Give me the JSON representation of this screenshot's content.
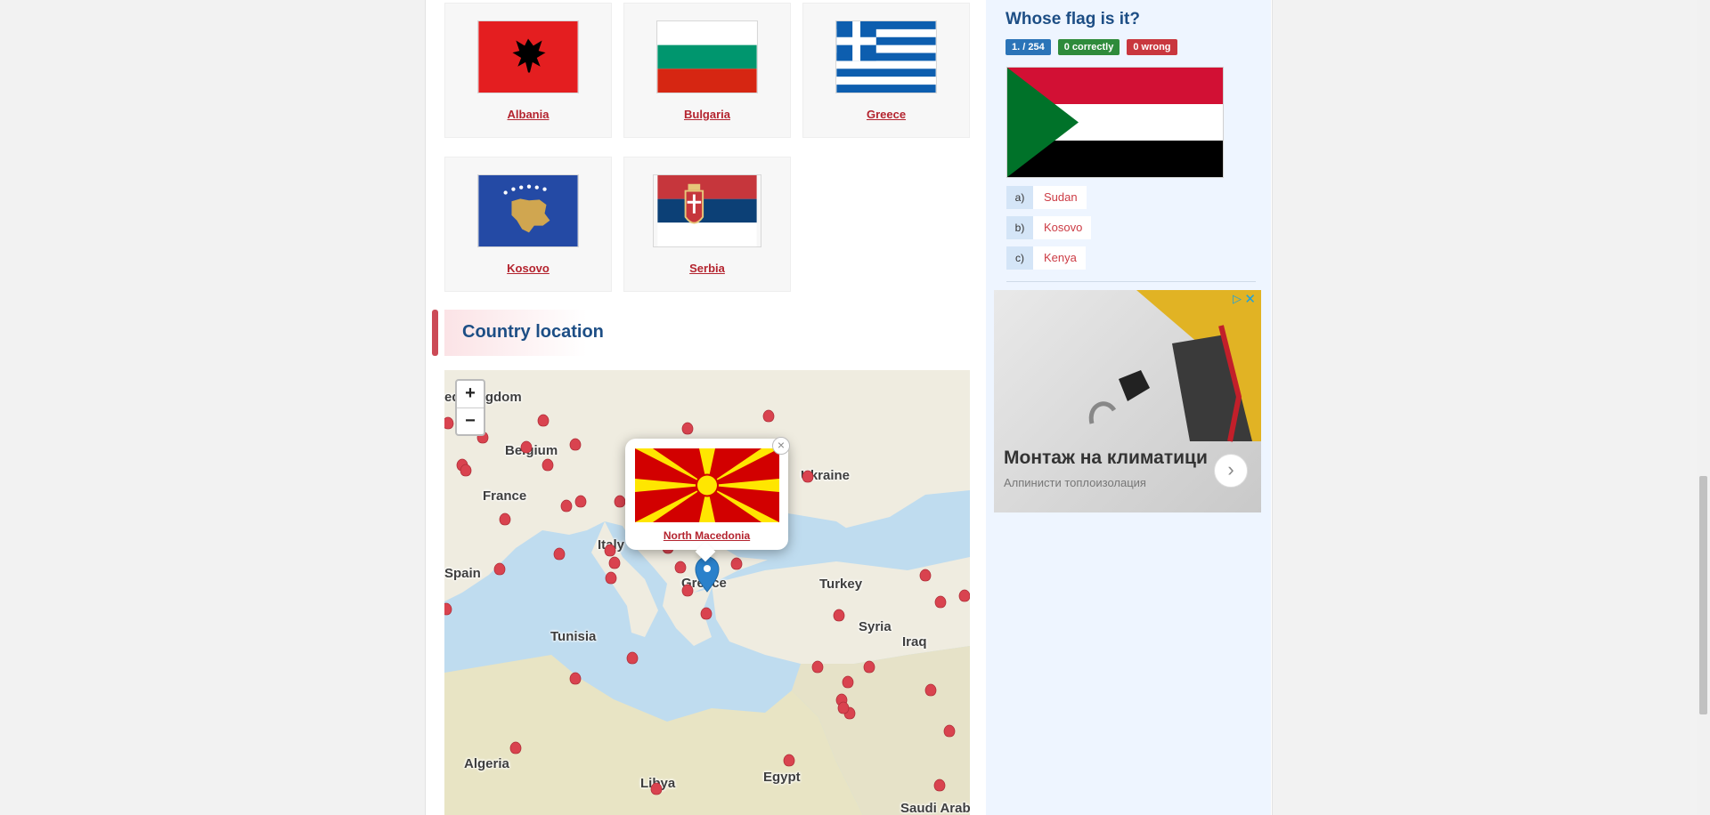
{
  "neighbors": [
    {
      "name": "Albania"
    },
    {
      "name": "Bulgaria"
    },
    {
      "name": "Greece"
    },
    {
      "name": "Kosovo"
    },
    {
      "name": "Serbia"
    }
  ],
  "section": {
    "title": "Country location"
  },
  "map": {
    "labels": [
      "ed Kingdom",
      "Belgium",
      "France",
      "Italy",
      "Spain",
      "Greece",
      "Turkey",
      "Ukraine",
      "Syria",
      "Iraq",
      "Tunisia",
      "Algeria",
      "Libya",
      "Egypt",
      "Saudi Arab"
    ],
    "zoom_in": "+",
    "zoom_out": "−",
    "popup": {
      "link": "North Macedonia",
      "close": "×"
    }
  },
  "quiz": {
    "title": "Whose flag is it?",
    "progress": "1. / 254",
    "correct": "0 correctly",
    "wrong": "0 wrong",
    "answers": [
      {
        "key": "a)",
        "text": "Sudan"
      },
      {
        "key": "b)",
        "text": "Kosovo"
      },
      {
        "key": "c)",
        "text": "Kenya"
      }
    ]
  },
  "ad": {
    "title": "Монтаж на климатици",
    "subtitle": "Алпинисти топлоизолация",
    "arrow": "›",
    "adchoices": "▷",
    "close": "✕"
  },
  "colors": {
    "accent": "#1d4e85",
    "link": "#b4242f",
    "map_water": "#bfdcef",
    "map_land": "#efece0",
    "marker": "#d9434f",
    "marker_selected": "#2a81cb"
  }
}
